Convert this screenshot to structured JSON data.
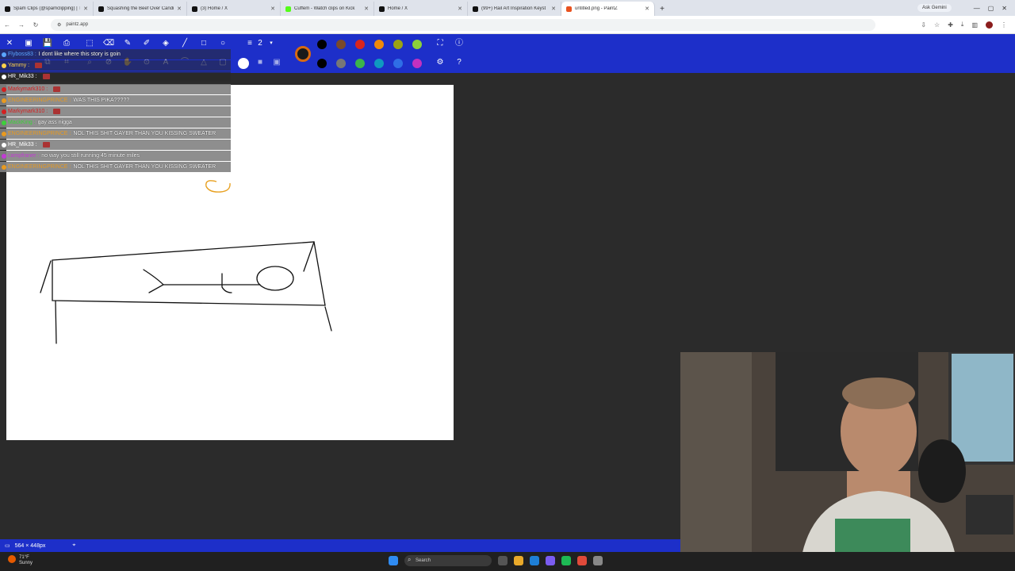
{
  "browser": {
    "tabs": [
      {
        "title": "Spam Clips (@spamclipping) | T",
        "color": "#111"
      },
      {
        "title": "Squashing the Beef Over Candi",
        "color": "#111"
      },
      {
        "title": "(3) Home / X",
        "color": "#111"
      },
      {
        "title": "Cuffem - Watch clips on Kick",
        "color": "#53fc18"
      },
      {
        "title": "Home / X",
        "color": "#111"
      },
      {
        "title": "(99+) Rail Art Inspiration Keyst",
        "color": "#111"
      },
      {
        "title": "untitled.png - PaintZ",
        "color": "#e8521f"
      }
    ],
    "new_tab": "+",
    "ask_gemini": "Ask Gemini",
    "url": "paintz.app"
  },
  "app": {
    "brush_size": "2",
    "colors_row1": [
      "#000000",
      "#7a4a2a",
      "#d9251d",
      "#ee8a0b",
      "#9aa314",
      "#8bd13a"
    ],
    "colors_row2": [
      "#000000",
      "#777777",
      "#3bb54a",
      "#0f9ac0",
      "#2f6ee6",
      "#c231c0"
    ],
    "primary_color": "#1a1a1a",
    "secondary_color": "#d86a10"
  },
  "chat": [
    {
      "user": "Flyboss83 :",
      "user_color": "#5aa6ff",
      "msg": "I dont like where this story is goin",
      "style": "dark"
    },
    {
      "user": "Yammy :",
      "user_color": "#ffd24a",
      "msg": "",
      "style": "dark"
    },
    {
      "user": "HR_Mik33 :",
      "user_color": "#ffffff",
      "msg": "",
      "style": "dark"
    },
    {
      "user": "Markymark310 :",
      "user_color": "#d42020",
      "msg": "",
      "style": "gray"
    },
    {
      "user": "ENGINEERINGPRINCE :",
      "user_color": "#e89a20",
      "msg": "WAS THIS PIKA?????",
      "style": "gray"
    },
    {
      "user": "Markymark310 :",
      "user_color": "#d42020",
      "msg": "",
      "style": "gray"
    },
    {
      "user": "MackKing :",
      "user_color": "#3dd13a",
      "msg": "gay ass nigga",
      "style": "gray"
    },
    {
      "user": "ENGINEERINGPRINCE :",
      "user_color": "#e89a20",
      "msg": "NOL THIS SHIT GAYER THAN YOU KISSING SWEATER",
      "style": "gray"
    },
    {
      "user": "HR_Mik33 :",
      "user_color": "#ffffff",
      "msg": "",
      "style": "gray"
    },
    {
      "user": "campfraner :",
      "user_color": "#c23bd4",
      "msg": "no way you still running 45 minute miles",
      "style": "gray"
    },
    {
      "user": "ENGINEERINGPRINCE :",
      "user_color": "#e89a20",
      "msg": "NOL THIS SHIT GAYER THAN YOU KISSING SWEATER",
      "style": "gray"
    }
  ],
  "status": {
    "canvas_size": "564 × 448px"
  },
  "taskbar": {
    "search": "Search",
    "temp": "71°F",
    "weather": "Sunny"
  }
}
